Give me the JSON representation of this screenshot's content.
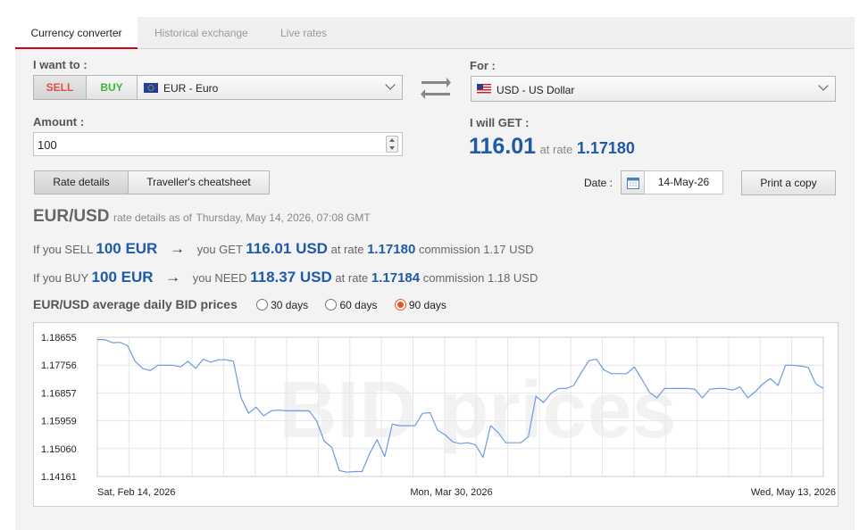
{
  "tabs": [
    "Currency converter",
    "Historical exchange",
    "Live rates"
  ],
  "want": {
    "label": "I want to :",
    "sell": "SELL",
    "buy": "BUY",
    "currency": "EUR - Euro"
  },
  "for": {
    "label": "For :",
    "currency": "USD - US Dollar"
  },
  "amount": {
    "label": "Amount :",
    "value": "100"
  },
  "get": {
    "label": "I will GET :",
    "value": "116.01",
    "at_rate": "at rate",
    "rate": "1.17180"
  },
  "buttons": {
    "rate_details": "Rate details",
    "cheatsheet": "Traveller's cheatsheet",
    "print": "Print a copy"
  },
  "date": {
    "label": "Date :",
    "value": "14-May-26"
  },
  "details": {
    "pair": "EUR/USD",
    "as_of_label": "rate details as of",
    "as_of": "Thursday, May 14, 2026, 07:08 GMT",
    "sell": {
      "prefix": "If you SELL",
      "amount": "100 EUR",
      "arrow": "→",
      "you": "you GET",
      "result": "116.01 USD",
      "at_rate": "at rate",
      "rate": "1.17180",
      "commission_label": "commission",
      "commission": "1.17 USD"
    },
    "buy": {
      "prefix": "If you BUY",
      "amount": "100 EUR",
      "arrow": "→",
      "you": "you NEED",
      "result": "118.37 USD",
      "at_rate": "at rate",
      "rate": "1.17184",
      "commission_label": "commission",
      "commission": "1.18 USD"
    }
  },
  "avg": {
    "title": "EUR/USD average daily BID prices",
    "options": [
      "30 days",
      "60 days",
      "90 days"
    ],
    "selected": "90 days"
  },
  "colors": {
    "sell": "#e84c3d",
    "buy": "#3cb83c",
    "line": "#6b9be0",
    "value": "#1f5aa6",
    "active_tab": "#d0021b"
  },
  "chart_data": {
    "type": "line",
    "watermark": "BID prices",
    "y_ticks": [
      "1.18655",
      "1.17756",
      "1.16857",
      "1.15959",
      "1.15060",
      "1.14161"
    ],
    "ylim": [
      1.14161,
      1.18655
    ],
    "x_ticks": [
      "Sat, Feb 14, 2026",
      "Mon, Mar 30, 2026",
      "Wed, May 13, 2026"
    ],
    "series": [
      {
        "values": [
          1.1858,
          1.1858,
          1.1848,
          1.1849,
          1.1838,
          1.1788,
          1.1765,
          1.1758,
          1.1775,
          1.1775,
          1.1775,
          1.177,
          1.1788,
          1.1765,
          1.1795,
          1.1785,
          1.1793,
          1.1793,
          1.1788,
          1.167,
          1.162,
          1.164,
          1.1612,
          1.1628,
          1.163,
          1.1628,
          1.1628,
          1.1628,
          1.1628,
          1.1595,
          1.153,
          1.151,
          1.1435,
          1.143,
          1.1432,
          1.1432,
          1.149,
          1.1535,
          1.148,
          1.1585,
          1.158,
          1.158,
          1.158,
          1.162,
          1.1622,
          1.1565,
          1.155,
          1.1528,
          1.1522,
          1.1525,
          1.1518,
          1.1478,
          1.158,
          1.1558,
          1.1525,
          1.1525,
          1.1525,
          1.1545,
          1.1675,
          1.1655,
          1.1685,
          1.17,
          1.17,
          1.171,
          1.1752,
          1.179,
          1.1795,
          1.176,
          1.1748,
          1.1748,
          1.1748,
          1.177,
          1.173,
          1.1688,
          1.167,
          1.17,
          1.17,
          1.17,
          1.17,
          1.1698,
          1.167,
          1.1698,
          1.17,
          1.17,
          1.1695,
          1.1705,
          1.167,
          1.169,
          1.1715,
          1.1732,
          1.171,
          1.1775,
          1.1775,
          1.1773,
          1.1768,
          1.1715,
          1.17
        ]
      }
    ]
  }
}
